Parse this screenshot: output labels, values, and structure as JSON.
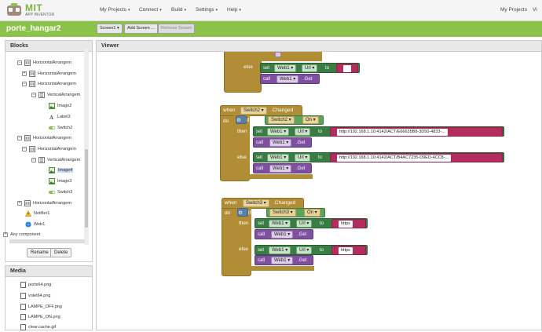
{
  "header": {
    "logo_title": "MIT",
    "logo_subtitle": "APP INVENTOR",
    "menus": [
      "My Projects",
      "Connect",
      "Build",
      "Settings",
      "Help"
    ],
    "right_menus": [
      "My Projects",
      "Vi"
    ]
  },
  "project": {
    "name": "porte_hangar2",
    "screen_button": "Screen1",
    "add_screen": "Add Screen ...",
    "remove_screen": "Remove Screen"
  },
  "blocks_panel": {
    "title": "Blocks",
    "tree": [
      {
        "label": "HorizontalArrangem",
        "toggle": "−"
      },
      {
        "label": "HorizontalArrangem",
        "toggle": "+"
      },
      {
        "label": "HorizontalArrangem",
        "toggle": "−"
      },
      {
        "label": "VerticalArrangem",
        "toggle": "−"
      },
      {
        "label": "Image2",
        "toggle": ""
      },
      {
        "label": "Label3",
        "toggle": ""
      },
      {
        "label": "Switch2",
        "toggle": ""
      },
      {
        "label": "HorizontalArrangem",
        "toggle": "−"
      },
      {
        "label": "HorizontalArrangem",
        "toggle": "−"
      },
      {
        "label": "VerticalArrangem",
        "toggle": "−"
      },
      {
        "label": "Image4",
        "toggle": ""
      },
      {
        "label": "Image3",
        "toggle": ""
      },
      {
        "label": "Switch3",
        "toggle": ""
      },
      {
        "label": "HorizontalArrangem",
        "toggle": "+"
      },
      {
        "label": "Notifier1",
        "toggle": ""
      },
      {
        "label": "Web1",
        "toggle": ""
      },
      {
        "label": "Any component",
        "toggle": "+"
      }
    ],
    "rename": "Rename",
    "delete": "Delete"
  },
  "media_panel": {
    "title": "Media",
    "files": [
      "porte64.png",
      "volet64.png",
      "LAMPE_OFF.png",
      "LAMPE_ON.png",
      "clear.cache.gif"
    ]
  },
  "viewer": {
    "title": "Viewer",
    "kw": {
      "else": "else",
      "set": "set",
      "to": "to",
      "call": "call",
      "when": "when",
      "do": "do",
      "if": "if",
      "then": "then",
      "changed": ".Changed",
      "get": ".Get",
      "url": "Url",
      "web1": "Web1",
      "on": "On"
    },
    "block2": {
      "switch": "Switch2",
      "then_url": "http://192.168.1.10:4142/ACT/E66635B8-3D50-4833-...",
      "else_url": "http://192.168.1.10:4142/ACT/B4AC7235-D9ED-4CC8-..."
    },
    "block3": {
      "switch": "Switch3",
      "then_url": "https",
      "else_url": "https"
    }
  }
}
